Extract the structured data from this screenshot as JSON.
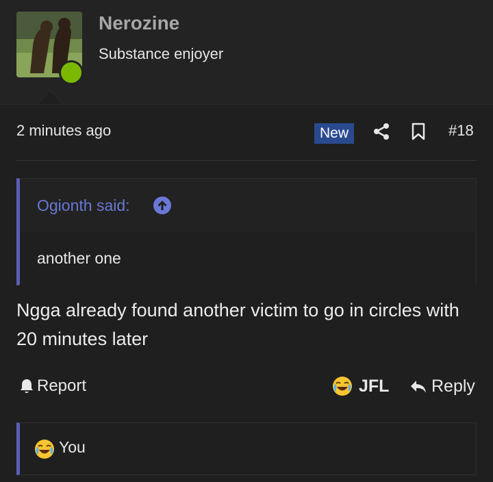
{
  "author": {
    "username": "Nerozine",
    "title": "Substance enjoyer",
    "status_color": "#7bb800",
    "avatar_icon": "bears-avatar"
  },
  "meta": {
    "timestamp": "2 minutes ago",
    "badge": "New",
    "post_number": "#18",
    "share_icon": "share-icon",
    "bookmark_icon": "bookmark-icon"
  },
  "quote": {
    "author_label": "Ogionth said:",
    "text": "another one",
    "accent_color": "#5a5fb5"
  },
  "post": {
    "body": "Ngga already found another victim to go in circles with 20 minutes later"
  },
  "actions": {
    "report_label": "Report",
    "reaction_label": "JFL",
    "reply_label": "Reply"
  },
  "reactions": {
    "user": "You",
    "emoji": "joy-crying-emoji"
  }
}
